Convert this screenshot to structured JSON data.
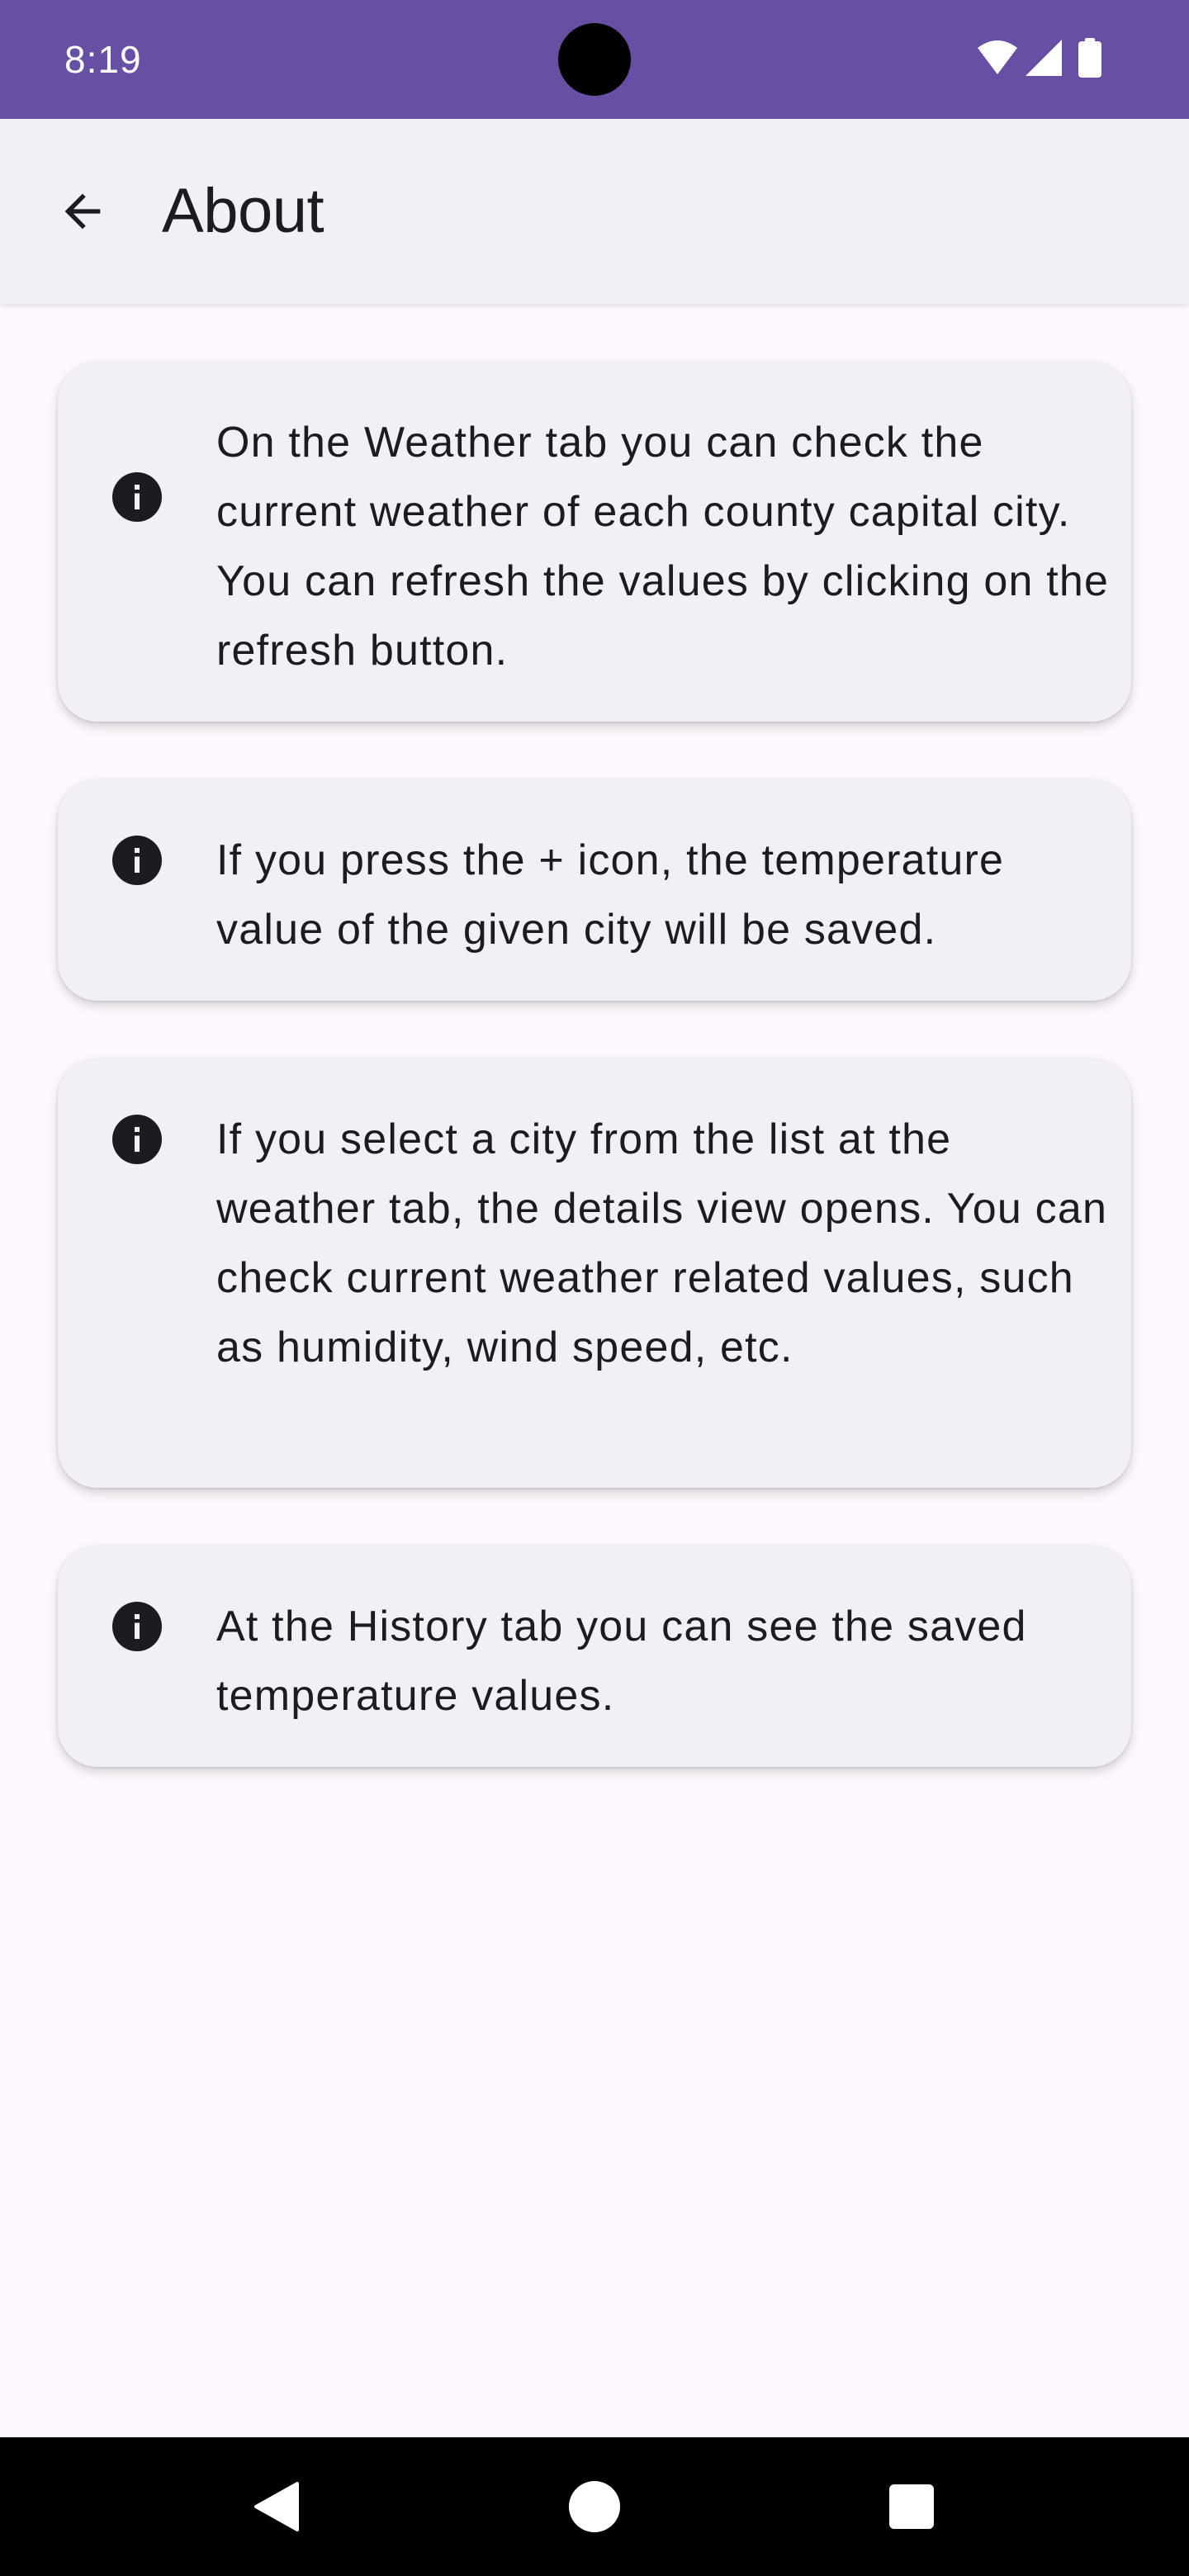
{
  "status_bar": {
    "time": "8:19",
    "icons": [
      "wifi-icon",
      "signal-icon",
      "battery-icon"
    ],
    "background": "#6750a4"
  },
  "app_bar": {
    "back_icon": "arrow-back-icon",
    "title": "About",
    "background": "#f3eff6"
  },
  "cards": [
    {
      "icon": "info-icon",
      "text": "On the Weather tab you can check the current weather of each county capital city. You can refresh the values by clicking on the refresh button."
    },
    {
      "icon": "info-icon",
      "text": "If you press the + icon, the temperature value of the given city will be saved."
    },
    {
      "icon": "info-icon",
      "text": "If you select a city from the list at the weather tab, the details view opens. You can check current weather related values, such as humidity, wind speed, etc."
    },
    {
      "icon": "info-icon",
      "text": "At the History tab you can see the saved temperature values."
    }
  ],
  "nav_bar": {
    "buttons": [
      "back-triangle-icon",
      "home-circle-icon",
      "recents-square-icon"
    ]
  },
  "colors": {
    "accent": "#6750a4",
    "surface": "#fdf8fd",
    "card": "#f3eff6",
    "text": "#1d1b20"
  }
}
